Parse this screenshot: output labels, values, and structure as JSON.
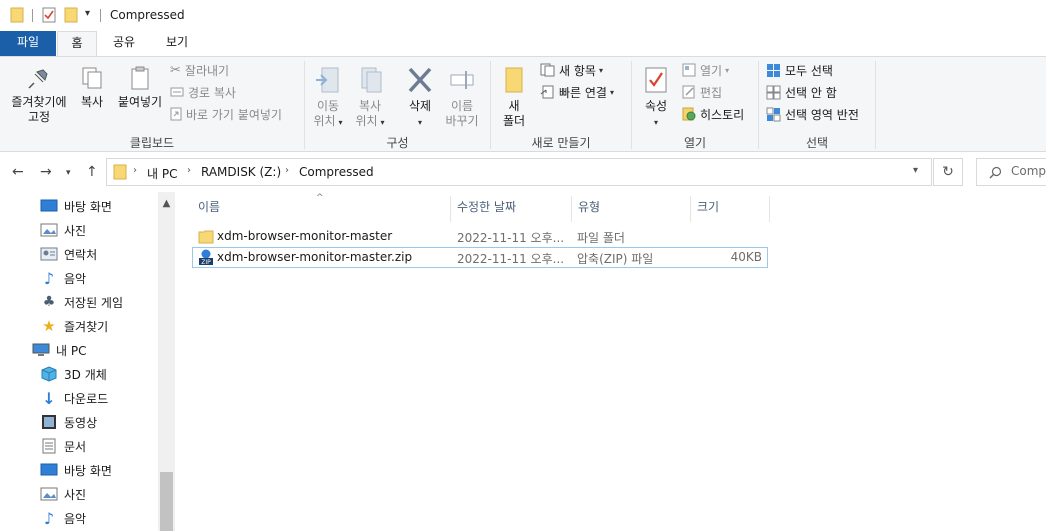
{
  "window": {
    "title": "Compressed"
  },
  "ribbon_tabs": {
    "file": "파일",
    "home": "홈",
    "share": "공유",
    "view": "보기"
  },
  "ribbon": {
    "clipboard": {
      "label": "클립보드",
      "pin": "즐겨찾기에\n고정",
      "pin_line1": "즐겨찾기에",
      "pin_line2": "고정",
      "copy": "복사",
      "paste": "붙여넣기",
      "cut": "잘라내기",
      "copy_path": "경로 복사",
      "paste_shortcut": "바로 가기 붙여넣기"
    },
    "organize": {
      "label": "구성",
      "move_line1": "이동",
      "move_line2": "위치",
      "copy_line1": "복사",
      "copy_line2": "위치",
      "delete": "삭제",
      "rename_line1": "이름",
      "rename_line2": "바꾸기"
    },
    "new": {
      "label": "새로 만들기",
      "folder_line1": "새",
      "folder_line2": "폴더",
      "new_item": "새 항목",
      "easy_access": "빠른 연결"
    },
    "open": {
      "label": "열기",
      "properties": "속성",
      "open": "열기",
      "edit": "편집",
      "history": "히스토리"
    },
    "select": {
      "label": "선택",
      "select_all": "모두 선택",
      "select_none": "선택 안 함",
      "invert": "선택 영역 반전"
    }
  },
  "address": {
    "segments": [
      "내 PC",
      "RAMDISK (Z:)",
      "Compressed"
    ],
    "search_placeholder": "Comp"
  },
  "nav_pane": {
    "items": [
      {
        "label": "바탕 화면",
        "icon": "desktop-icon"
      },
      {
        "label": "사진",
        "icon": "pictures-icon"
      },
      {
        "label": "연락처",
        "icon": "contacts-icon"
      },
      {
        "label": "음악",
        "icon": "music-icon"
      },
      {
        "label": "저장된 게임",
        "icon": "saved-games-icon"
      },
      {
        "label": "즐겨찾기",
        "icon": "favorites-icon"
      },
      {
        "label": "내 PC",
        "icon": "this-pc-icon"
      },
      {
        "label": "3D 개체",
        "icon": "3d-objects-icon"
      },
      {
        "label": "다운로드",
        "icon": "downloads-icon"
      },
      {
        "label": "동영상",
        "icon": "videos-icon"
      },
      {
        "label": "문서",
        "icon": "documents-icon"
      },
      {
        "label": "바탕 화면",
        "icon": "desktop-icon"
      },
      {
        "label": "사진",
        "icon": "pictures-icon"
      },
      {
        "label": "음악",
        "icon": "music-icon"
      }
    ]
  },
  "file_list": {
    "columns": [
      "이름",
      "수정한 날짜",
      "유형",
      "크기"
    ],
    "rows": [
      {
        "name": "xdm-browser-monitor-master",
        "modified": "2022-11-11 오후...",
        "type": "파일 폴더",
        "size": ""
      },
      {
        "name": "xdm-browser-monitor-master.zip",
        "modified": "2022-11-11 오후...",
        "type": "압축(ZIP) 파일",
        "size": "40KB"
      }
    ]
  },
  "colors": {
    "file_tab": "#1b5fa8",
    "accent": "#0078d7",
    "folder": "#f8d775",
    "selection_border": "#99c9ef"
  }
}
